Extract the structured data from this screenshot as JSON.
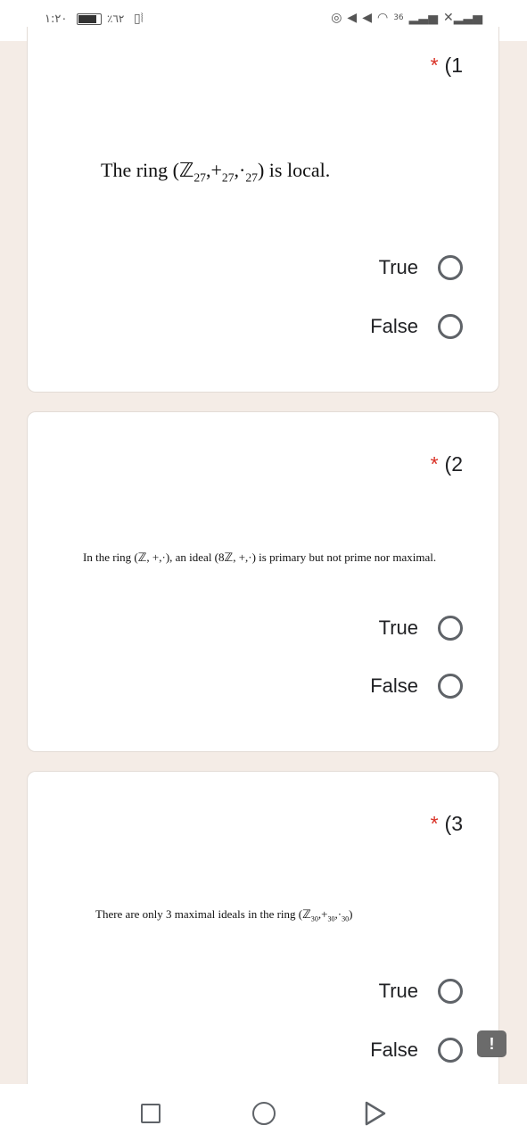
{
  "status_bar": {
    "time": "١:٢٠",
    "battery_percent": "٪٦٢",
    "network_label": "36"
  },
  "questions": [
    {
      "number": "(1",
      "required_mark": "*",
      "text_prefix": "The ring (ℤ",
      "text_sub1": "27",
      "text_mid1": ",+",
      "text_sub2": "27",
      "text_mid2": ",·",
      "text_sub3": "27",
      "text_suffix": ") is local.",
      "options": [
        "True",
        "False"
      ]
    },
    {
      "number": "(2",
      "required_mark": "*",
      "text": "In the ring (ℤ, +,·), an ideal (8ℤ, +,·) is primary but not prime nor maximal.",
      "options": [
        "True",
        "False"
      ]
    },
    {
      "number": "(3",
      "required_mark": "*",
      "text_prefix": "There are only 3 maximal ideals in the ring  (ℤ",
      "text_sub1": "30",
      "text_mid1": ",+",
      "text_sub2": "30",
      "text_mid2": ",·",
      "text_sub3": "30",
      "text_suffix": ")",
      "options": [
        "True",
        "False"
      ]
    }
  ],
  "feedback_button": {
    "label": "!"
  },
  "nav_bar": {
    "recents_icon": "square",
    "home_icon": "circle",
    "back_icon": "triangle"
  }
}
